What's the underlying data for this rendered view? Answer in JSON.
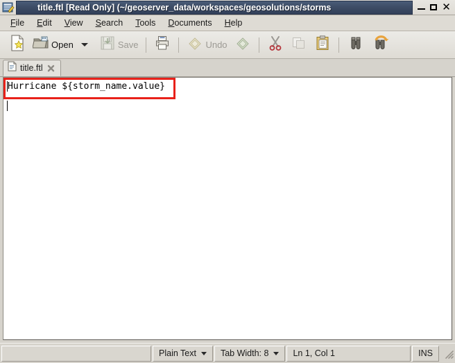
{
  "window": {
    "title": "title.ftl [Read Only] (~/geoserver_data/workspaces/geosolutions/storms",
    "icon": "gedit-icon",
    "buttons": {
      "minimize": "minimize-button",
      "maximize": "maximize-button",
      "close": "close-button",
      "close_glyph": "✕"
    }
  },
  "menubar": {
    "items": [
      {
        "label": "File",
        "mnemonic": "F"
      },
      {
        "label": "Edit",
        "mnemonic": "E"
      },
      {
        "label": "View",
        "mnemonic": "V"
      },
      {
        "label": "Search",
        "mnemonic": "S"
      },
      {
        "label": "Tools",
        "mnemonic": "T"
      },
      {
        "label": "Documents",
        "mnemonic": "D"
      },
      {
        "label": "Help",
        "mnemonic": "H"
      }
    ]
  },
  "toolbar": {
    "new_label": "",
    "open_label": "Open",
    "save_label": "Save",
    "print_label": "",
    "undo_label": "Undo",
    "redo_label": "",
    "cut_label": "",
    "copy_label": "",
    "paste_label": "",
    "find_label": "",
    "replace_label": ""
  },
  "tabs": [
    {
      "label": "title.ftl",
      "active": true,
      "close": "×"
    }
  ],
  "editor": {
    "line1": "Hurricane ${storm_name.value}"
  },
  "annotation": {
    "color": "#e8211a"
  },
  "statusbar": {
    "blank": "",
    "language": "Plain Text",
    "tab_width": "Tab Width: 8",
    "position": "Ln 1, Col 1",
    "insert_mode": "INS"
  }
}
